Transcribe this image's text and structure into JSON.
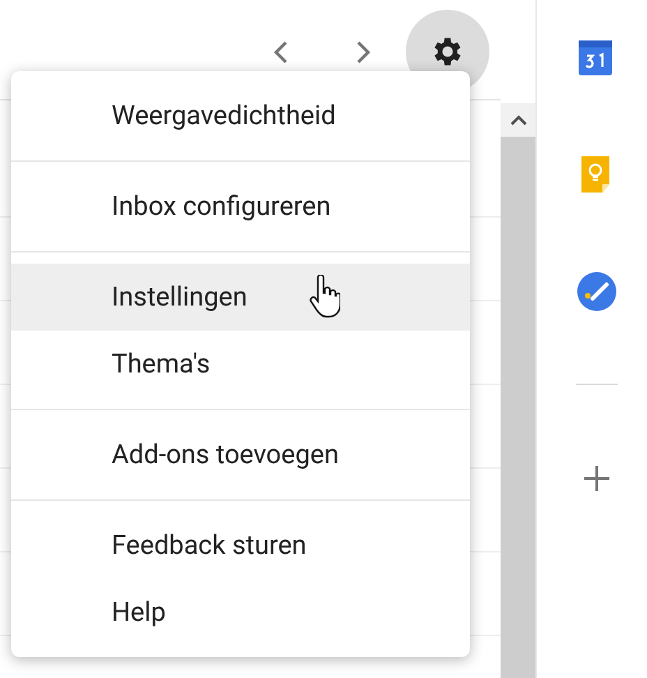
{
  "menu": {
    "sections": [
      [
        {
          "label": "Weergavedichtheid",
          "hovered": false
        }
      ],
      [
        {
          "label": "Inbox configureren",
          "hovered": false
        }
      ],
      [
        {
          "label": "Instellingen",
          "hovered": true
        },
        {
          "label": "Thema's",
          "hovered": false
        }
      ],
      [
        {
          "label": "Add-ons toevoegen",
          "hovered": false
        }
      ],
      [
        {
          "label": "Feedback sturen",
          "hovered": false
        },
        {
          "label": "Help",
          "hovered": false
        }
      ]
    ]
  }
}
